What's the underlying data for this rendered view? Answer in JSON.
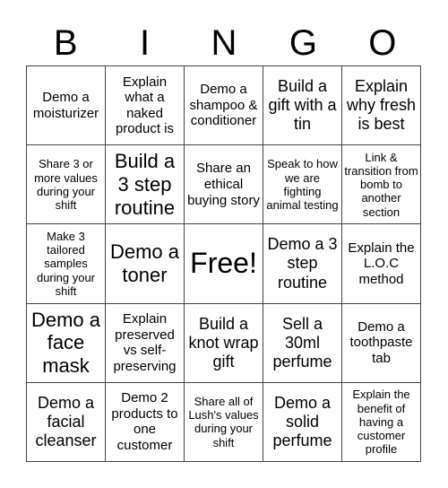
{
  "header": [
    "B",
    "I",
    "N",
    "G",
    "O"
  ],
  "cells": [
    {
      "text": "Demo a moisturizer",
      "size": "s2"
    },
    {
      "text": "Explain what a naked product is",
      "size": "s2"
    },
    {
      "text": "Demo a shampoo & conditioner",
      "size": "s2"
    },
    {
      "text": "Build a gift with a tin",
      "size": "s3"
    },
    {
      "text": "Explain why fresh is best",
      "size": "s3"
    },
    {
      "text": "Share 3 or more values during your shift",
      "size": "s1"
    },
    {
      "text": "Build a 3 step routine",
      "size": "s4"
    },
    {
      "text": "Share an ethical buying story",
      "size": "s2"
    },
    {
      "text": "Speak to how we are fighting animal testing",
      "size": "s1"
    },
    {
      "text": "Link & transition from bomb to another section",
      "size": "s1"
    },
    {
      "text": "Make 3 tailored samples during your shift",
      "size": "s1"
    },
    {
      "text": "Demo a toner",
      "size": "s4"
    },
    {
      "text": "Free!",
      "size": "s5"
    },
    {
      "text": "Demo a 3 step routine",
      "size": "s3"
    },
    {
      "text": "Explain the L.O.C method",
      "size": "s2"
    },
    {
      "text": "Demo a face mask",
      "size": "s4"
    },
    {
      "text": "Explain preserved vs self-preserving",
      "size": "s2"
    },
    {
      "text": "Build a knot wrap gift",
      "size": "s3"
    },
    {
      "text": "Sell a 30ml perfume",
      "size": "s3"
    },
    {
      "text": "Demo a toothpaste tab",
      "size": "s2"
    },
    {
      "text": "Demo a facial cleanser",
      "size": "s3"
    },
    {
      "text": "Demo 2 products to one customer",
      "size": "s2"
    },
    {
      "text": "Share all of Lush's values during your shift",
      "size": "s1"
    },
    {
      "text": "Demo a solid perfume",
      "size": "s3"
    },
    {
      "text": "Explain the benefit of having a customer profile",
      "size": "s1"
    }
  ]
}
